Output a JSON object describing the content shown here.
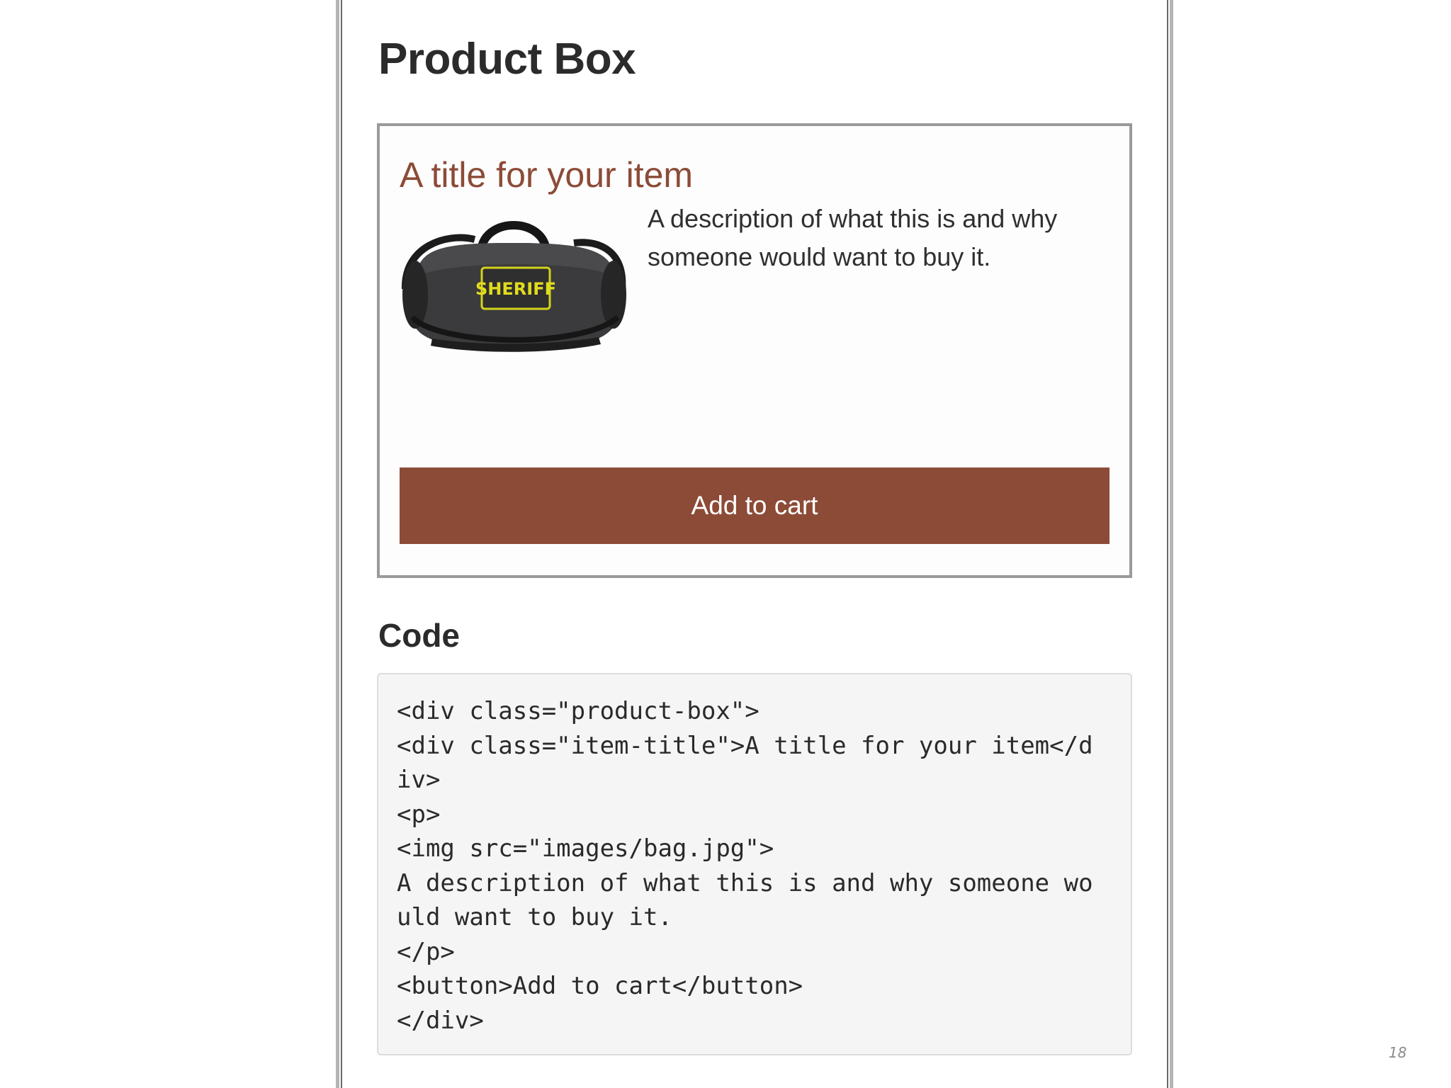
{
  "page": {
    "heading": "Product Box",
    "code_heading": "Code",
    "page_number": "18"
  },
  "product": {
    "title": "A title for your item",
    "description": "A description of what this is and why someone would want to buy it.",
    "button_label": "Add to cart",
    "image": {
      "icon": "duffel-bag-image",
      "patch_text": "SHERIFF"
    }
  },
  "code": {
    "lines": [
      "<div class=\"product-box\">",
      "<div class=\"item-title\">A title for your item</d",
      "iv>",
      "<p>",
      "<img src=\"images/bag.jpg\">",
      "A description of what this is and why someone wo",
      "uld want to buy it.",
      "</p>",
      "<button>Add to cart</button>",
      "</div>"
    ]
  },
  "colors": {
    "accent": "#8c4b37",
    "text": "#2b2b2b",
    "code_background": "#f5f5f5",
    "box_border": "#9a9a9a"
  }
}
